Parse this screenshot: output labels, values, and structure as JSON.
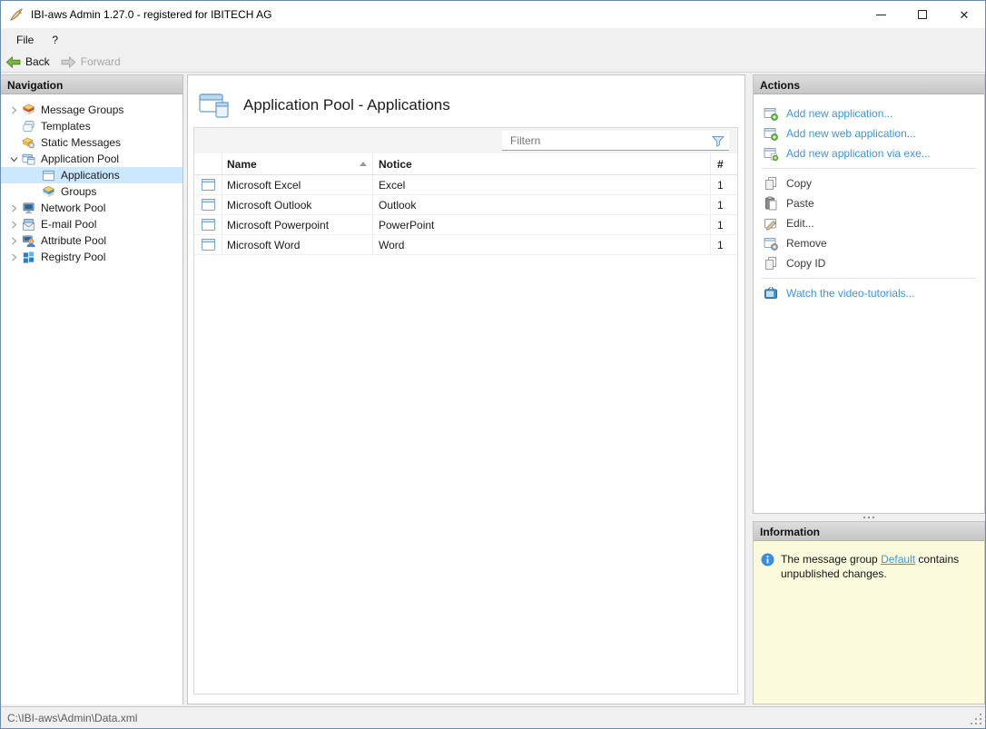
{
  "window": {
    "title": "IBI-aws Admin 1.27.0 - registered for IBITECH AG"
  },
  "menu": {
    "items": [
      "File",
      "?"
    ]
  },
  "toolbar": {
    "back_label": "Back",
    "forward_label": "Forward"
  },
  "navigation": {
    "header": "Navigation",
    "items": [
      {
        "label": "Message Groups",
        "icon": "message-groups-icon",
        "chevron": "collapsed",
        "level": 0,
        "selected": false
      },
      {
        "label": "Templates",
        "icon": "templates-icon",
        "chevron": "none",
        "level": 0,
        "selected": false
      },
      {
        "label": "Static Messages",
        "icon": "static-messages-icon",
        "chevron": "none",
        "level": 0,
        "selected": false
      },
      {
        "label": "Application Pool",
        "icon": "application-pool-icon",
        "chevron": "expanded",
        "level": 0,
        "selected": false
      },
      {
        "label": "Applications",
        "icon": "applications-icon",
        "chevron": "none",
        "level": 1,
        "selected": true
      },
      {
        "label": "Groups",
        "icon": "groups-icon",
        "chevron": "none",
        "level": 1,
        "selected": false
      },
      {
        "label": "Network Pool",
        "icon": "network-pool-icon",
        "chevron": "collapsed",
        "level": 0,
        "selected": false
      },
      {
        "label": "E-mail Pool",
        "icon": "email-pool-icon",
        "chevron": "collapsed",
        "level": 0,
        "selected": false
      },
      {
        "label": "Attribute Pool",
        "icon": "attribute-pool-icon",
        "chevron": "collapsed",
        "level": 0,
        "selected": false
      },
      {
        "label": "Registry Pool",
        "icon": "registry-pool-icon",
        "chevron": "collapsed",
        "level": 0,
        "selected": false
      }
    ]
  },
  "main": {
    "title": "Application Pool - Applications",
    "filter_placeholder": "Filtern",
    "table": {
      "columns": [
        "Name",
        "Notice",
        "#"
      ],
      "sorted_column": "Name",
      "sort_direction": "ascending",
      "rows": [
        {
          "name": "Microsoft Excel",
          "notice": "Excel",
          "count": "1"
        },
        {
          "name": "Microsoft Outlook",
          "notice": "Outlook",
          "count": "1"
        },
        {
          "name": "Microsoft Powerpoint",
          "notice": "PowerPoint",
          "count": "1"
        },
        {
          "name": "Microsoft Word",
          "notice": "Word",
          "count": "1"
        }
      ]
    }
  },
  "actions": {
    "header": "Actions",
    "add_links": [
      {
        "label": "Add new application..."
      },
      {
        "label": "Add new web application..."
      },
      {
        "label": "Add new application via exe..."
      }
    ],
    "commands": [
      {
        "label": "Copy"
      },
      {
        "label": "Paste"
      },
      {
        "label": "Edit..."
      },
      {
        "label": "Remove"
      },
      {
        "label": "Copy ID"
      }
    ],
    "tutorial": {
      "label": "Watch the video-tutorials..."
    }
  },
  "information": {
    "header": "Information",
    "text_before": "The message group ",
    "link_label": "Default",
    "text_after": " contains unpublished changes."
  },
  "statusbar": {
    "path": "C:\\IBI-aws\\Admin\\Data.xml"
  },
  "colors": {
    "link_blue": "#3e96da",
    "selection_blue": "#cbe8ff",
    "info_background": "#fbfadc",
    "panel_header_gray": "#cecece"
  }
}
